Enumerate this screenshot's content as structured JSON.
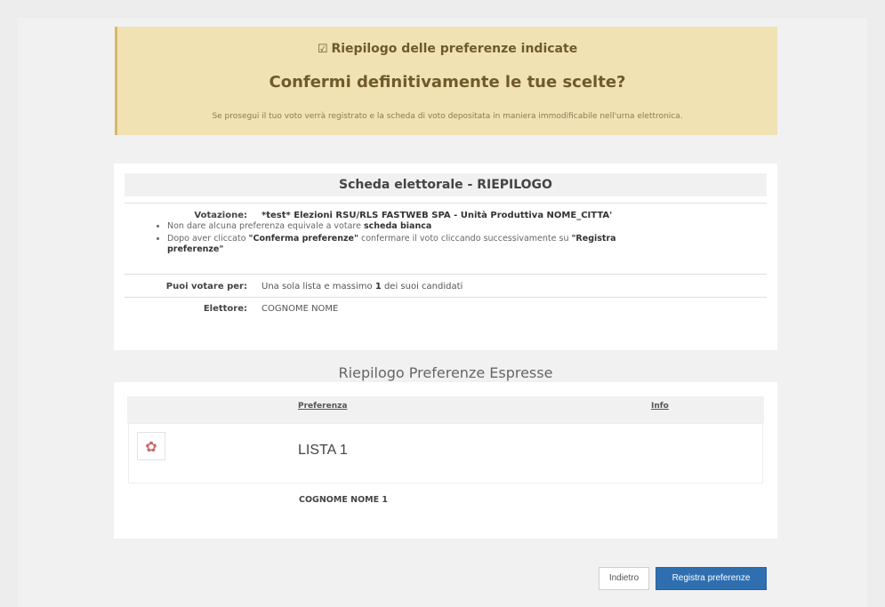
{
  "banner": {
    "heading": "Riepilogo delle preferenze indicate",
    "heading_icon": "checkbox-icon",
    "question": "Confermi definitivamente le tue scelte?",
    "note": "Se prosegui il tuo voto verrà registrato e la scheda di voto depositata in maniera immodificabile nell'urna elettronica."
  },
  "ballot": {
    "title": "Scheda elettorale - RIEPILOGO",
    "votazione_label": "Votazione:",
    "votazione_value": "*test* Elezioni RSU/RLS FASTWEB SPA - Unità Produttiva NOME_CITTA'",
    "bullet1_pre": "Non dare alcuna preferenza equivale a votare ",
    "bullet1_bold": "scheda bianca",
    "bullet2_pre": "Dopo aver cliccato ",
    "bullet2_bold1": "\"Conferma preferenze\"",
    "bullet2_mid": " confermare il voto cliccando successivamente su ",
    "bullet2_bold2": "\"Registra preferenze\"",
    "puoi_label": "Puoi votare per:",
    "puoi_pre": "Una sola lista e massimo ",
    "puoi_num": "1",
    "puoi_post": " dei suoi candidati",
    "elettore_label": "Elettore:",
    "elettore_value": "COGNOME NOME"
  },
  "preferences": {
    "heading": "Riepilogo Preferenze Espresse",
    "col_preferenza": "Preferenza",
    "col_info": "Info",
    "list_logo_icon": "list-logo-icon",
    "list_name": "LISTA 1",
    "candidate": "COGNOME NOME 1"
  },
  "footer": {
    "back_label": "Indietro",
    "register_label": "Registra preferenze"
  },
  "colors": {
    "banner_bg": "#f1e2b3",
    "primary_button": "#2f6fb0"
  }
}
